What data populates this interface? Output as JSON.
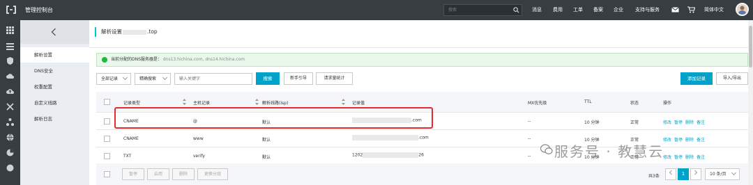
{
  "topbar": {
    "brand": "管理控制台",
    "search_placeholder": "搜索",
    "nav": [
      "消息",
      "费用",
      "工单",
      "备案",
      "企业",
      "支持与服务"
    ],
    "lang": "简体中文"
  },
  "sidebar": {
    "items": [
      {
        "label": "解析设置",
        "active": true
      },
      {
        "label": "DNS安全",
        "active": false
      },
      {
        "label": "权重配置",
        "active": false
      },
      {
        "label": "自定义线路",
        "active": false
      },
      {
        "label": "解析日志",
        "active": false
      }
    ]
  },
  "page": {
    "title_prefix": "解析设置",
    "title_suffix": ".top",
    "notice_label": "当前分配的DNS服务器是：",
    "notice_servers": "dns13.hichina.com, dns14.hichina.com"
  },
  "toolbar": {
    "record_filter": "全部记录",
    "search_mode": "精确搜索",
    "keyword_placeholder": "输入关键字",
    "search_button": "搜索",
    "guide_button": "新手引导",
    "stats_button": "请求量统计",
    "add_button": "添加记录",
    "import_button": "导入/导出"
  },
  "table": {
    "columns": [
      "记录类型",
      "主机记录",
      "解析线路(isp)",
      "记录值",
      "MX优先级",
      "TTL",
      "状态",
      "操作"
    ],
    "rows": [
      {
        "type": "CNAME",
        "host": "@",
        "line": "默认",
        "value_suffix": ".com",
        "mx": "--",
        "ttl": "10 分钟",
        "status": "正常",
        "actions": [
          "修改",
          "暂停",
          "删除",
          "备注"
        ]
      },
      {
        "type": "CNAME",
        "host": "www",
        "line": "默认",
        "value_suffix": ".com",
        "mx": "--",
        "ttl": "10 分钟",
        "status": "正常",
        "actions": [
          "修改",
          "暂停",
          "删除",
          "备注"
        ]
      },
      {
        "type": "TXT",
        "host": "verify",
        "line": "默认",
        "value_prefix": "1202",
        "value_suffix": "26",
        "mx": "--",
        "ttl": "10 分钟",
        "status": "正常",
        "actions": [
          "修改",
          "暂停",
          "删除",
          "备注"
        ]
      }
    ]
  },
  "footer": {
    "bulk_buttons": [
      "暂停",
      "启用",
      "删除",
      "更换分组"
    ],
    "total": "共3条",
    "current_page": "1",
    "page_size": "10 条/页"
  },
  "watermark": "服务号 · 教慧云",
  "colors": {
    "topbar": "#373d41",
    "accent": "#00a2ca",
    "success": "#1db83c",
    "highlight": "#e22b2b"
  }
}
